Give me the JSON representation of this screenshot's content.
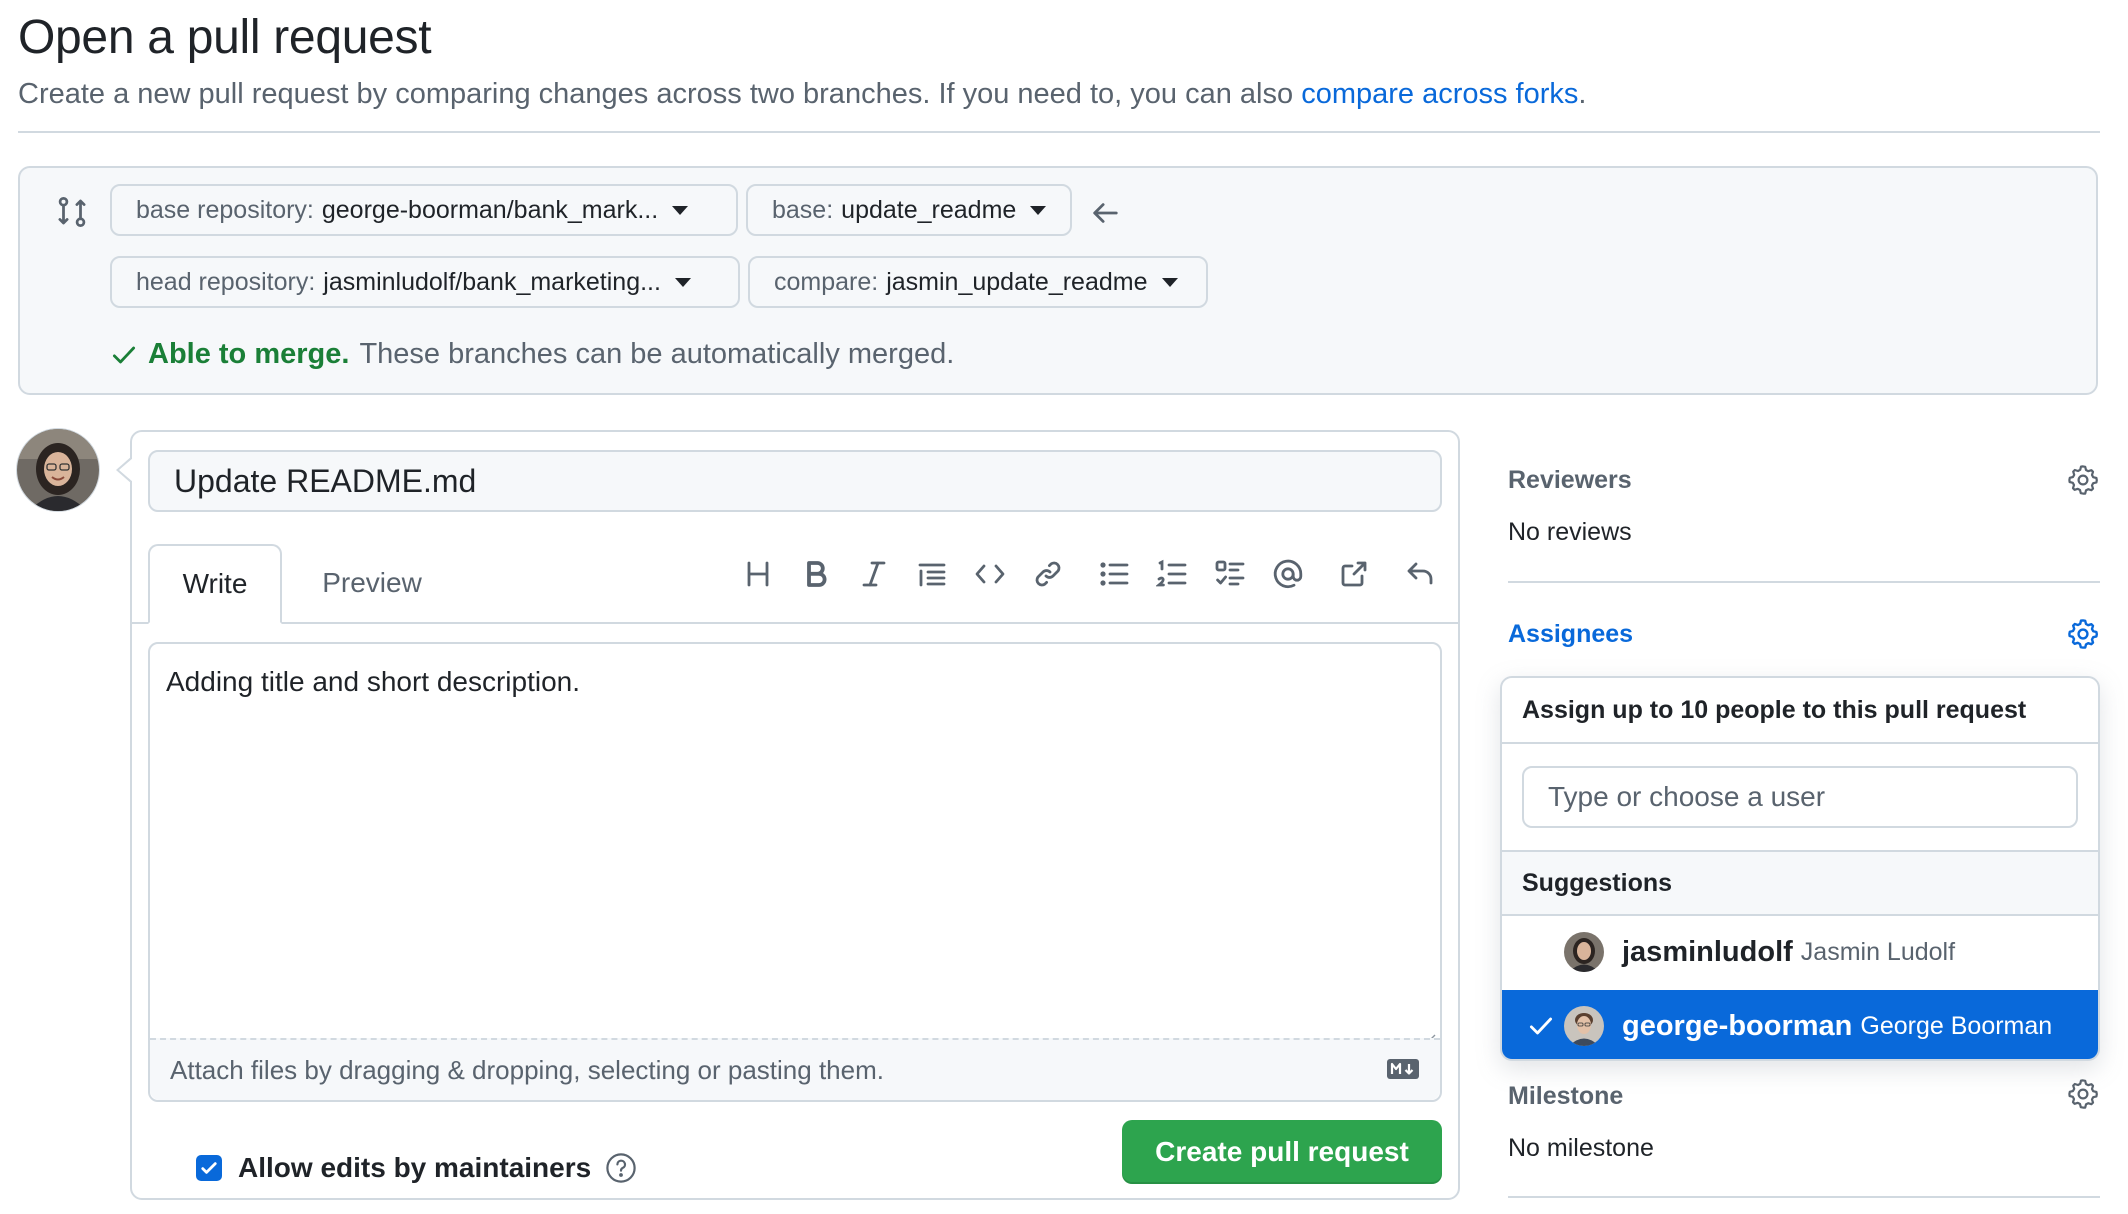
{
  "header": {
    "title": "Open a pull request",
    "subtitle": "Create a new pull request by comparing changes across two branches. If you need to, you can also ",
    "subtitle_link": "compare across forks",
    "subtitle_end": "."
  },
  "compare": {
    "base_repo_label": "base repository:",
    "base_repo_value": "george-boorman/bank_mark...",
    "base_label": "base:",
    "base_value": "update_readme",
    "head_repo_label": "head repository:",
    "head_repo_value": "jasminludolf/bank_marketing...",
    "compare_label": "compare:",
    "compare_value": "jasmin_update_readme",
    "merge_status": "Able to merge.",
    "merge_text": "These branches can be automatically merged."
  },
  "editor": {
    "title_value": "Update README.md",
    "tab_write": "Write",
    "tab_preview": "Preview",
    "body_text": "Adding title and short description.",
    "attach_text": "Attach files by dragging & dropping, selecting or pasting them.",
    "allow_edits_label": "Allow edits by maintainers",
    "create_button": "Create pull request"
  },
  "sidebar": {
    "reviewers_label": "Reviewers",
    "reviewers_value": "No reviews",
    "assignees_label": "Assignees",
    "milestone_label": "Milestone",
    "milestone_value": "No milestone",
    "assignee_dropdown": {
      "header": "Assign up to 10 people to this pull request",
      "filter_placeholder": "Type or choose a user",
      "suggestions_label": "Suggestions",
      "users": [
        {
          "login": "jasminludolf",
          "name": "Jasmin Ludolf",
          "selected": false
        },
        {
          "login": "george-boorman",
          "name": "George Boorman",
          "selected": true
        }
      ]
    }
  },
  "colors": {
    "accent": "#0969da",
    "success": "#1a7f37",
    "button_green": "#2da44e",
    "border": "#d1d9e0",
    "muted": "#59636e"
  }
}
